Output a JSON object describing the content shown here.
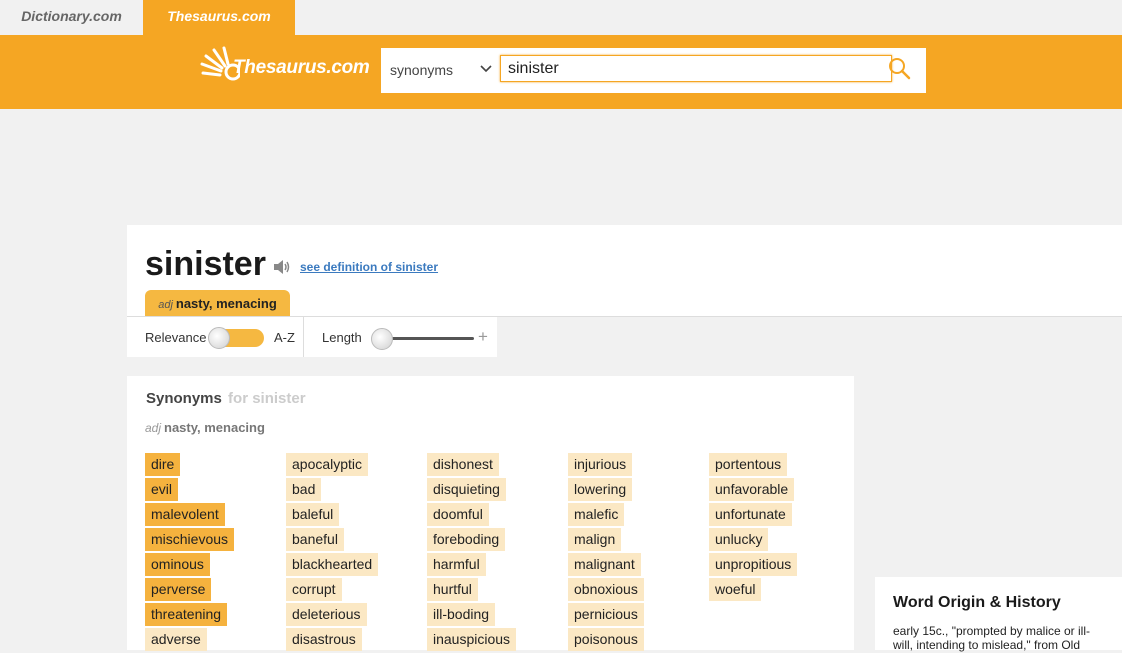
{
  "site_tabs": {
    "dictionary": "Dictionary.com",
    "thesaurus": "Thesaurus.com"
  },
  "logo": {
    "text": "Thesaurus.com"
  },
  "search": {
    "type": "synonyms",
    "value": "sinister"
  },
  "entry": {
    "word": "sinister",
    "definition_link": "see definition of sinister",
    "sense_pos": "adj",
    "sense_label": "nasty, menacing"
  },
  "filters": {
    "relevance": "Relevance",
    "az": "A-Z",
    "length": "Length",
    "plus": "+"
  },
  "synonyms": {
    "title": "Synonyms",
    "for_text": "for sinister",
    "sense_pos": "adj",
    "sense_label": "nasty, menacing",
    "columns": [
      [
        "dire",
        "evil",
        "malevolent",
        "mischievous",
        "ominous",
        "perverse",
        "threatening",
        "adverse"
      ],
      [
        "apocalyptic",
        "bad",
        "baleful",
        "baneful",
        "blackhearted",
        "corrupt",
        "deleterious",
        "disastrous"
      ],
      [
        "dishonest",
        "disquieting",
        "doomful",
        "foreboding",
        "harmful",
        "hurtful",
        "ill-boding",
        "inauspicious"
      ],
      [
        "injurious",
        "lowering",
        "malefic",
        "malign",
        "malignant",
        "obnoxious",
        "pernicious",
        "poisonous"
      ],
      [
        "portentous",
        "unfavorable",
        "unfortunate",
        "unlucky",
        "unpropitious",
        "woeful"
      ]
    ],
    "strong_count": 7
  },
  "origin": {
    "title": "Word Origin & History",
    "text": "early 15c., \"prompted by malice or ill-will, intending to mislead,\" from Old"
  },
  "colors": {
    "accent": "#f5a623",
    "strong": "#f5b23e",
    "weak": "#fbe8c4",
    "link": "#3b7abf"
  }
}
